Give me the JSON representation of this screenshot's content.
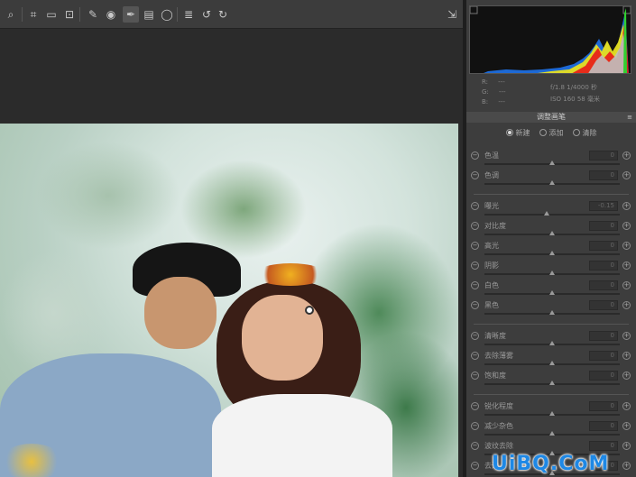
{
  "toolbar": {
    "tools": [
      {
        "name": "zoom-tool-icon",
        "glyph": "⌕"
      },
      {
        "name": "crop-tool-icon",
        "glyph": "⌗"
      },
      {
        "name": "straighten-tool-icon",
        "glyph": "▭"
      },
      {
        "name": "transform-tool-icon",
        "glyph": "⊡"
      },
      {
        "name": "spot-removal-tool-icon",
        "glyph": "✎"
      },
      {
        "name": "red-eye-tool-icon",
        "glyph": "◉"
      },
      {
        "name": "adjustment-brush-icon",
        "glyph": "✒"
      },
      {
        "name": "graduated-filter-icon",
        "glyph": "▤"
      },
      {
        "name": "radial-filter-icon",
        "glyph": "◯"
      },
      {
        "name": "preferences-icon",
        "glyph": "≣"
      },
      {
        "name": "rotate-left-icon",
        "glyph": "↺"
      },
      {
        "name": "rotate-right-icon",
        "glyph": "↻"
      }
    ],
    "export_icon": "⇲"
  },
  "camera_info": {
    "r_label": "R:",
    "g_label": "G:",
    "b_label": "B:",
    "r_value": "---",
    "g_value": "---",
    "b_value": "---",
    "aperture_shutter": "f/1.8  1/4000 秒",
    "iso_focal": "ISO 160  58 毫米"
  },
  "panel": {
    "section_title": "调整画笔",
    "modes": [
      {
        "label": "新建",
        "selected": true
      },
      {
        "label": "添加",
        "selected": false
      },
      {
        "label": "清除",
        "selected": false
      }
    ],
    "sliders": [
      {
        "label": "色温",
        "value": "0",
        "position": 0.5
      },
      {
        "label": "色调",
        "value": "0",
        "position": 0.5
      },
      {
        "label": "曝光",
        "value": "-0.15",
        "position": 0.46
      },
      {
        "label": "对比度",
        "value": "0",
        "position": 0.5
      },
      {
        "label": "高光",
        "value": "0",
        "position": 0.5
      },
      {
        "label": "阴影",
        "value": "0",
        "position": 0.5
      },
      {
        "label": "白色",
        "value": "0",
        "position": 0.5
      },
      {
        "label": "黑色",
        "value": "0",
        "position": 0.5
      },
      {
        "label": "清晰度",
        "value": "0",
        "position": 0.5
      },
      {
        "label": "去除薄雾",
        "value": "0",
        "position": 0.5
      },
      {
        "label": "饱和度",
        "value": "0",
        "position": 0.5
      },
      {
        "label": "锐化程度",
        "value": "0",
        "position": 0.5
      },
      {
        "label": "减少杂色",
        "value": "0",
        "position": 0.5
      },
      {
        "label": "波纹去除",
        "value": "0",
        "position": 0.5
      },
      {
        "label": "去边",
        "value": "0",
        "position": 0.5
      }
    ]
  },
  "watermark": "UiBQ.CoM",
  "colors": {
    "accent": "#1e88e5",
    "panel_bg": "#3d3d3d",
    "toolbar_bg": "#3c3c3c"
  }
}
